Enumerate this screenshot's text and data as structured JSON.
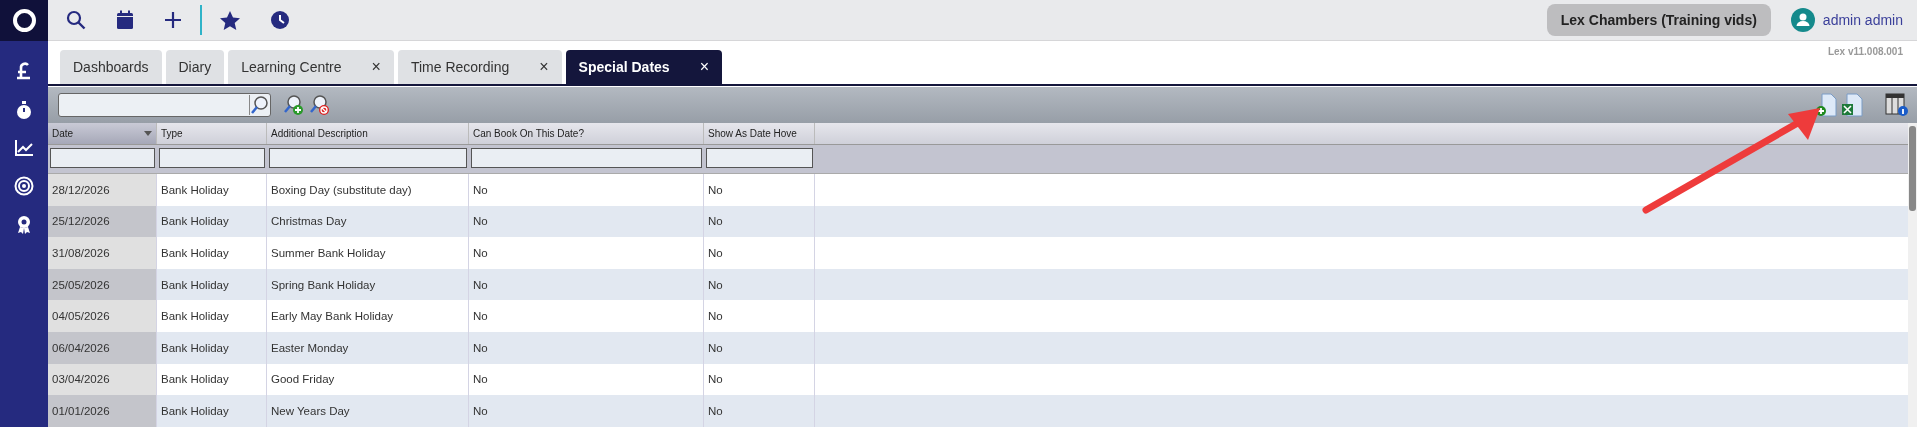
{
  "top_bar": {
    "organisation": "Lex Chambers (Training vids)",
    "user": "admin admin"
  },
  "version": "Lex v11.008.001",
  "tabs": [
    {
      "label": "Dashboards",
      "selected": false,
      "closable": false
    },
    {
      "label": "Diary",
      "selected": false,
      "closable": false
    },
    {
      "label": "Learning Centre",
      "selected": false,
      "closable": true
    },
    {
      "label": "Time Recording",
      "selected": false,
      "closable": true
    },
    {
      "label": "Special Dates",
      "selected": true,
      "closable": true
    }
  ],
  "close_glyph": "×",
  "table": {
    "columns": [
      {
        "label": "Date",
        "sorted": true
      },
      {
        "label": "Type",
        "sorted": false
      },
      {
        "label": "Additional Description",
        "sorted": false
      },
      {
        "label": "Can Book On This Date?",
        "sorted": false
      },
      {
        "label": "Show As Date Hove",
        "sorted": false
      }
    ],
    "rows": [
      [
        "28/12/2026",
        "Bank Holiday",
        "Boxing Day (substitute day)",
        "No",
        "No"
      ],
      [
        "25/12/2026",
        "Bank Holiday",
        "Christmas Day",
        "No",
        "No"
      ],
      [
        "31/08/2026",
        "Bank Holiday",
        "Summer Bank Holiday",
        "No",
        "No"
      ],
      [
        "25/05/2026",
        "Bank Holiday",
        "Spring Bank Holiday",
        "No",
        "No"
      ],
      [
        "04/05/2026",
        "Bank Holiday",
        "Early May Bank Holiday",
        "No",
        "No"
      ],
      [
        "06/04/2026",
        "Bank Holiday",
        "Easter Monday",
        "No",
        "No"
      ],
      [
        "03/04/2026",
        "Bank Holiday",
        "Good Friday",
        "No",
        "No"
      ],
      [
        "01/01/2026",
        "Bank Holiday",
        "New Years Day",
        "No",
        "No"
      ]
    ]
  }
}
